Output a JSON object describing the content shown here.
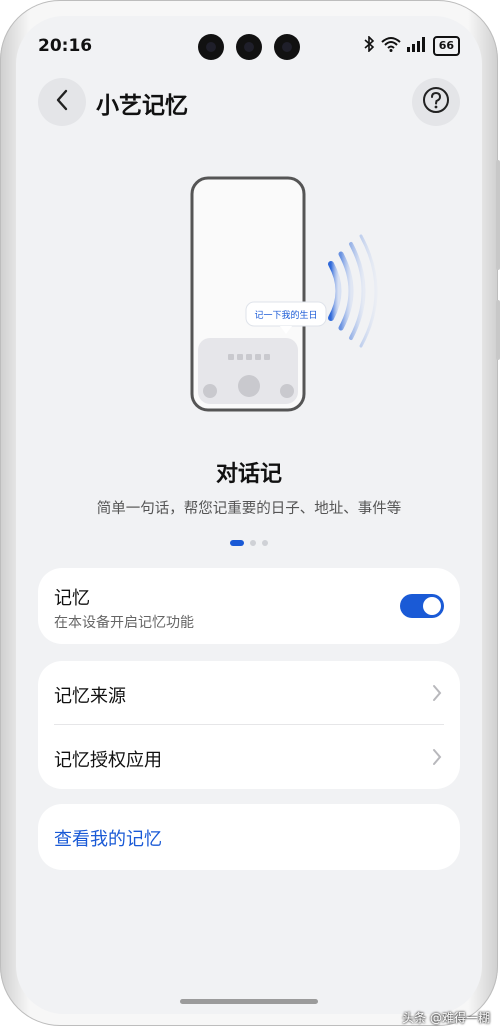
{
  "status_bar": {
    "time": "20:16",
    "battery": "66"
  },
  "header": {
    "title": "小艺记忆",
    "back_icon": "chevron-left-icon",
    "help_icon": "question-icon"
  },
  "illustration": {
    "bubble_text": "记一下我的生日"
  },
  "feature": {
    "title": "对话记",
    "description": "简单一句话，帮您记重要的日子、地址、事件等"
  },
  "pager": {
    "count": 3,
    "active_index": 0
  },
  "memory_toggle": {
    "title": "记忆",
    "subtitle": "在本设备开启记忆功能",
    "enabled": true
  },
  "settings_list": {
    "items": [
      {
        "label": "记忆来源"
      },
      {
        "label": "记忆授权应用"
      }
    ]
  },
  "view_memory": {
    "label": "查看我的记忆"
  },
  "watermark": "头条 @难得一糊",
  "colors": {
    "accent": "#1a5ad6",
    "background": "#f1f2f4",
    "card": "#ffffff"
  }
}
